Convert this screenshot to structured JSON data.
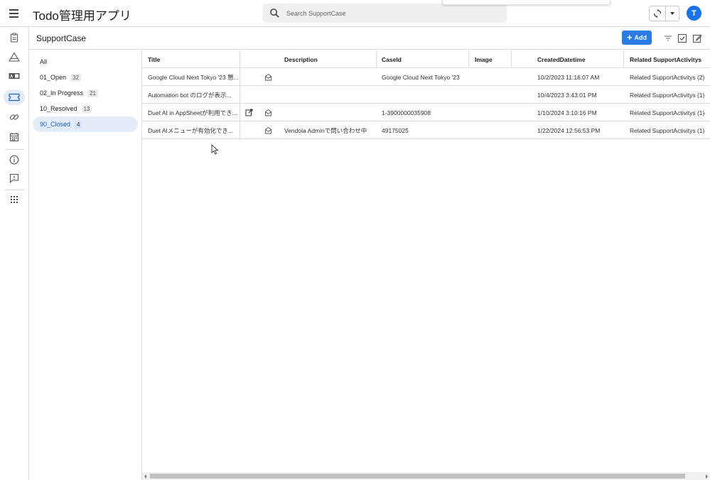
{
  "app": {
    "title": "Todo管理用アプリ",
    "user_initial": "T"
  },
  "search": {
    "placeholder": "Search SupportCase"
  },
  "rail": {
    "items": [
      {
        "icon": "clipboard-icon"
      },
      {
        "icon": "warning-triangle-icon"
      },
      {
        "icon": "badge-icon"
      },
      {
        "icon": "ticket-icon"
      },
      {
        "icon": "link-icon"
      },
      {
        "icon": "calendar-icon"
      },
      {
        "icon": "info-icon"
      },
      {
        "icon": "feedback-icon"
      },
      {
        "icon": "apps-grid-icon"
      }
    ]
  },
  "header": {
    "table_name": "SupportCase",
    "add_label": "Add"
  },
  "groups": [
    {
      "label": "All",
      "count": ""
    },
    {
      "label": "01_Open",
      "count": "32"
    },
    {
      "label": "02_In Progress",
      "count": "21"
    },
    {
      "label": "10_Resolved",
      "count": "13"
    },
    {
      "label": "90_Closed",
      "count": "4"
    }
  ],
  "table": {
    "columns": [
      "Title",
      "Description",
      "CaseId",
      "Image",
      "CreatedDatetime",
      "Related SupportActivitys"
    ],
    "rows": [
      {
        "title": "Google Cloud Next Tokyo '23 懇...",
        "description": "",
        "case_id": "Google Cloud Next Tokyo '23",
        "image": "",
        "created": "10/2/2023 11:16:07 AM",
        "related": "Related SupportActivitys (2)"
      },
      {
        "title": "Automation bot のログが表示...",
        "description": "",
        "case_id": "",
        "image": "",
        "created": "10/4/2023 3:43:01 PM",
        "related": "Related SupportActivitys (1)"
      },
      {
        "title": "Duet AI in AppSheetが利用でき...",
        "description": "",
        "case_id": "1-3900000035908",
        "image": "",
        "created": "1/10/2024 3:10:16 PM",
        "related": "Related SupportActivitys (1)"
      },
      {
        "title": "Duet AIメニューが有効化でき...",
        "description": "Vendola Adminで問い合わせ中",
        "case_id": "49175025",
        "image": "",
        "created": "1/22/2024 12:56:53 PM",
        "related": "Related SupportActivitys (1)"
      }
    ]
  },
  "colors": {
    "accent": "#2c7be5",
    "avatar": "#1a73e8",
    "selected_bg": "#e3ecf8"
  }
}
